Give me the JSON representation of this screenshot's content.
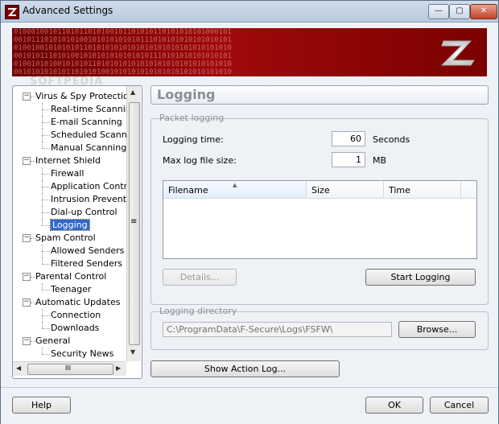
{
  "window": {
    "title": "Advanced Settings",
    "min_glyph": "—",
    "max_glyph": "▢",
    "close_glyph": "✕"
  },
  "banner": {
    "bits": "01000100101101011010100101101010110101010101000101\n00101110101010100101010101010111010101010101010101\n01001001010101011010101010101010101010101010101010\n00101011101010010101010101010101110101010101010101\n01001010100101010110101010101010101010101010101010\n00101010101011010101001010101010101010101010101010",
    "watermark": "SOFTPEDIA"
  },
  "tree": {
    "items": [
      {
        "label": "Virus & Spy Protection",
        "level": 0,
        "expander": "−"
      },
      {
        "label": "Real-time Scanning",
        "level": 1
      },
      {
        "label": "E-mail Scanning",
        "level": 1
      },
      {
        "label": "Scheduled Scanning",
        "level": 1
      },
      {
        "label": "Manual Scanning",
        "level": 1
      },
      {
        "label": "Internet Shield",
        "level": 0,
        "expander": "−"
      },
      {
        "label": "Firewall",
        "level": 1
      },
      {
        "label": "Application Control",
        "level": 1
      },
      {
        "label": "Intrusion Prevention",
        "level": 1
      },
      {
        "label": "Dial-up Control",
        "level": 1
      },
      {
        "label": "Logging",
        "level": 1,
        "selected": true
      },
      {
        "label": "Spam Control",
        "level": 0,
        "expander": "−"
      },
      {
        "label": "Allowed Senders",
        "level": 1
      },
      {
        "label": "Filtered Senders",
        "level": 1
      },
      {
        "label": "Parental Control",
        "level": 0,
        "expander": "−"
      },
      {
        "label": "Teenager",
        "level": 1
      },
      {
        "label": "Automatic Updates",
        "level": 0,
        "expander": "−"
      },
      {
        "label": "Connection",
        "level": 1
      },
      {
        "label": "Downloads",
        "level": 1
      },
      {
        "label": "General",
        "level": 0,
        "expander": "−"
      },
      {
        "label": "Security News",
        "level": 1
      }
    ],
    "vscroll_grip": "≡",
    "hscroll_grip": "III",
    "arrow_up": "▲",
    "arrow_down": "▼",
    "arrow_left": "◀",
    "arrow_right": "▶"
  },
  "page": {
    "title": "Logging"
  },
  "packet_logging": {
    "legend": "Packet logging",
    "logging_time_label": "Logging time:",
    "logging_time_value": "60",
    "logging_time_unit": "Seconds",
    "max_size_label": "Max log file size:",
    "max_size_value": "1",
    "max_size_unit": "MB",
    "columns": [
      "Filename",
      "Size",
      "Time"
    ],
    "sort_arrow": "▲",
    "details_button": "Details...",
    "start_button": "Start Logging"
  },
  "logging_directory": {
    "legend": "Logging directory",
    "path": "C:\\ProgramData\\F-Secure\\Logs\\FSFW\\",
    "browse_button": "Browse..."
  },
  "show_action_log_button": "Show Action Log...",
  "footer": {
    "help_button": "Help",
    "ok_button": "OK",
    "cancel_button": "Cancel"
  },
  "colors": {
    "selection": "#3168c8",
    "banner": "#8b0000",
    "window_border": "#5a6f86"
  }
}
